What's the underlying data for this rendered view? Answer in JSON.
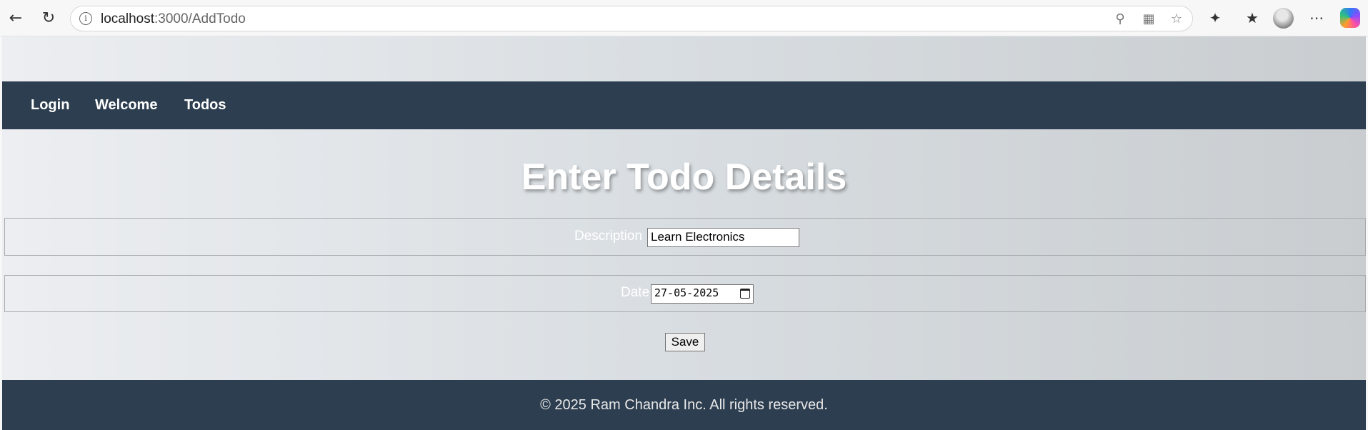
{
  "browser": {
    "url_host": "localhost",
    "url_path": ":3000/AddTodo"
  },
  "nav": {
    "items": [
      "Login",
      "Welcome",
      "Todos"
    ]
  },
  "form": {
    "title": "Enter Todo Details",
    "description_label": "Description",
    "description_value": "Learn Electronics",
    "date_label": "Date",
    "date_value": "27-05-2025",
    "save_label": "Save"
  },
  "footer": {
    "text": "© 2025 Ram Chandra Inc. All rights reserved."
  },
  "colors": {
    "navbar": "#2d3e50",
    "footer": "#2d3e50"
  }
}
